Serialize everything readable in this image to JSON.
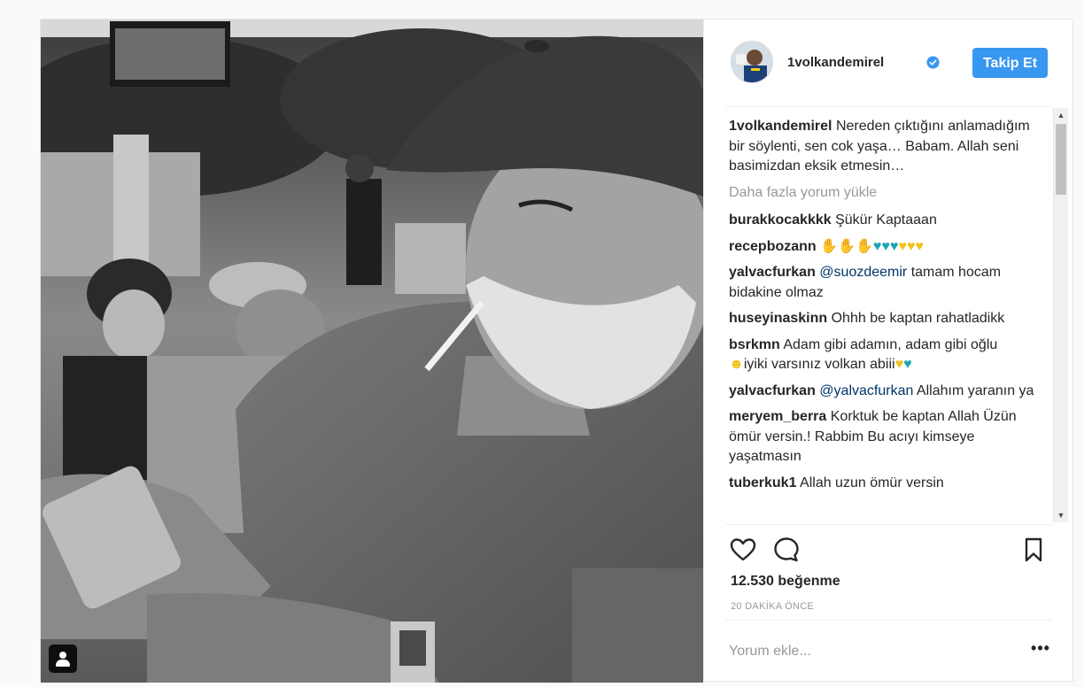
{
  "post": {
    "author": {
      "username": "1volkandemirel",
      "verified": true,
      "avatar_alt": "avatar"
    },
    "follow_label": "Takip Et",
    "caption": {
      "username": "1volkandemirel",
      "text": "Nereden çıktığını anlamadığım bir söylenti, sen cok yaşa… Babam. Allah seni basimizdan eksik etmesin…"
    },
    "load_more_label": "Daha fazla yorum yükle",
    "comments": [
      {
        "user": "burakkocakkkk",
        "text": "Şükür Kaptaaan"
      },
      {
        "user": "recepbozann",
        "text": ""
      },
      {
        "user": "yalvacfurkan",
        "mention": "@suozdeemir",
        "text": " tamam hocam bidakine olmaz"
      },
      {
        "user": "huseyinaskinn",
        "text": "Ohhh be kaptan rahatladikk"
      },
      {
        "user": "bsrkmn",
        "text": "Adam gibi adamın, adam gibi oğlu",
        "text2": "iyiki varsınız volkan abiii"
      },
      {
        "user": "yalvacfurkan",
        "mention": "@yalvacfurkan",
        "text": " Allahım yaranın ya"
      },
      {
        "user": "meryem_berra",
        "text": "Korktuk be kaptan Allah Üzün ömür versin.! Rabbim Bu acıyı kimseye yaşatmasın"
      },
      {
        "user": "tuberkuk1",
        "text": "Allah uzun ömür versin"
      }
    ],
    "likes": "12.530 beğenme",
    "timestamp": "20 DAKİKA ÖNCE",
    "comment_placeholder": "Yorum ekle...",
    "more_label": "•••"
  },
  "colors": {
    "follow_button": "#3897f0",
    "verified_badge": "#3897f0",
    "mention": "#003569"
  },
  "icons": {
    "like": "heart-icon",
    "comment": "comment-bubble-icon",
    "save": "bookmark-icon",
    "tagged": "user-tag-icon"
  }
}
